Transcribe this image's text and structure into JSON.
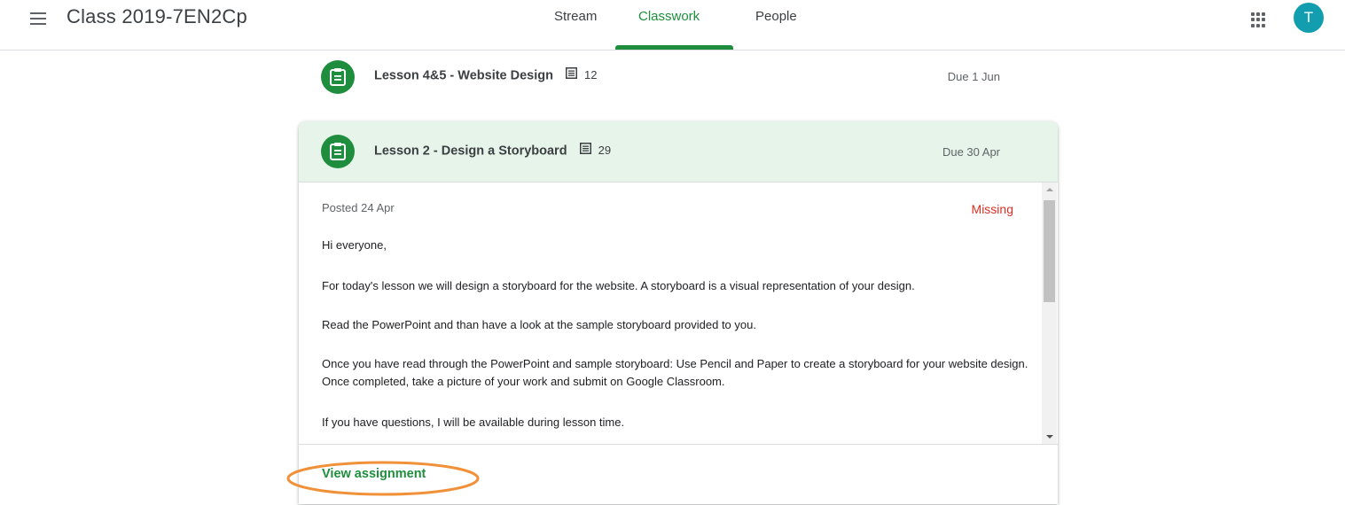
{
  "header": {
    "class_title": "Class 2019-7EN2Cp",
    "tabs": [
      {
        "label": "Stream"
      },
      {
        "label": "Classwork"
      },
      {
        "label": "People"
      }
    ],
    "active_tab": "Classwork",
    "avatar_initial": "T"
  },
  "assignments": [
    {
      "title": "Lesson 4&5 - Website Design",
      "comment_count": "12",
      "due": "Due 1 Jun"
    },
    {
      "title": "Lesson 2 - Design a Storyboard",
      "comment_count": "29",
      "due": "Due 30 Apr"
    }
  ],
  "expanded": {
    "posted": "Posted 24 Apr",
    "status": "Missing",
    "paragraphs": [
      "Hi everyone,",
      "For today's lesson we will design a storyboard for the website. A storyboard is a visual representation of your design.",
      "Read the PowerPoint and than have a look at the sample storyboard provided to you.",
      "Once you have read through the PowerPoint and sample storyboard: Use Pencil and Paper to create a storyboard for your website design. Once completed, take a picture of your work and submit on Google Classroom.",
      "If you have questions, I will be available during lesson time."
    ],
    "view_link": "View assignment"
  },
  "colors": {
    "accent_green": "#1e8e3e",
    "header_tint": "#e6f4ea",
    "missing_red": "#d93025",
    "avatar_teal": "#129eaf",
    "highlight_orange": "#f0913a"
  }
}
